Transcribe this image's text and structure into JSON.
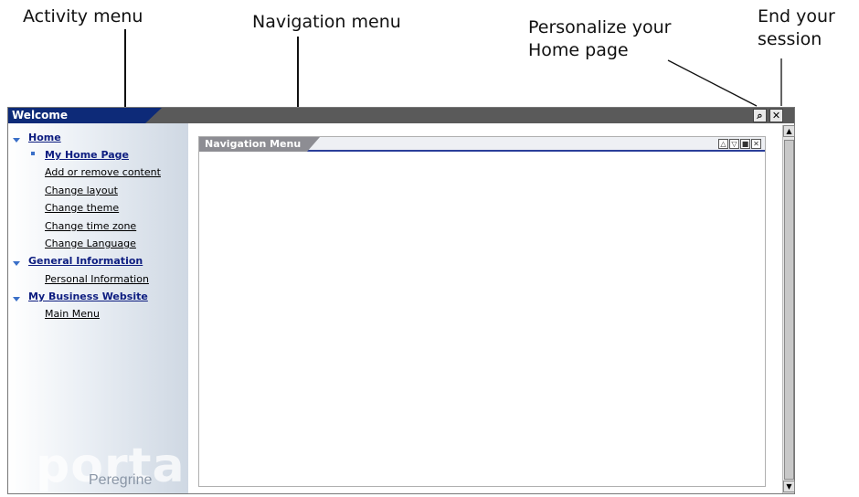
{
  "callouts": {
    "activity": "Activity menu",
    "navigation": "Navigation menu",
    "personalize_1": "Personalize your",
    "personalize_2": "Home page",
    "end_1": "End your",
    "end_2": "session"
  },
  "window": {
    "title": "Welcome",
    "personalize_icon": "magnifier-icon",
    "close_icon": "close-icon"
  },
  "sidebar": {
    "home": "Home",
    "my_home_page": "My Home Page",
    "add_remove": "Add or remove content",
    "change_layout": "Change layout",
    "change_theme": "Change theme",
    "change_time_zone": "Change time zone",
    "change_language": "Change Language",
    "general_info": "General Information",
    "personal_info": "Personal Information",
    "business_site": "My Business Website",
    "main_menu": "Main Menu",
    "watermark": "portal",
    "brand": "Peregrine"
  },
  "panel": {
    "title": "Navigation Menu"
  }
}
